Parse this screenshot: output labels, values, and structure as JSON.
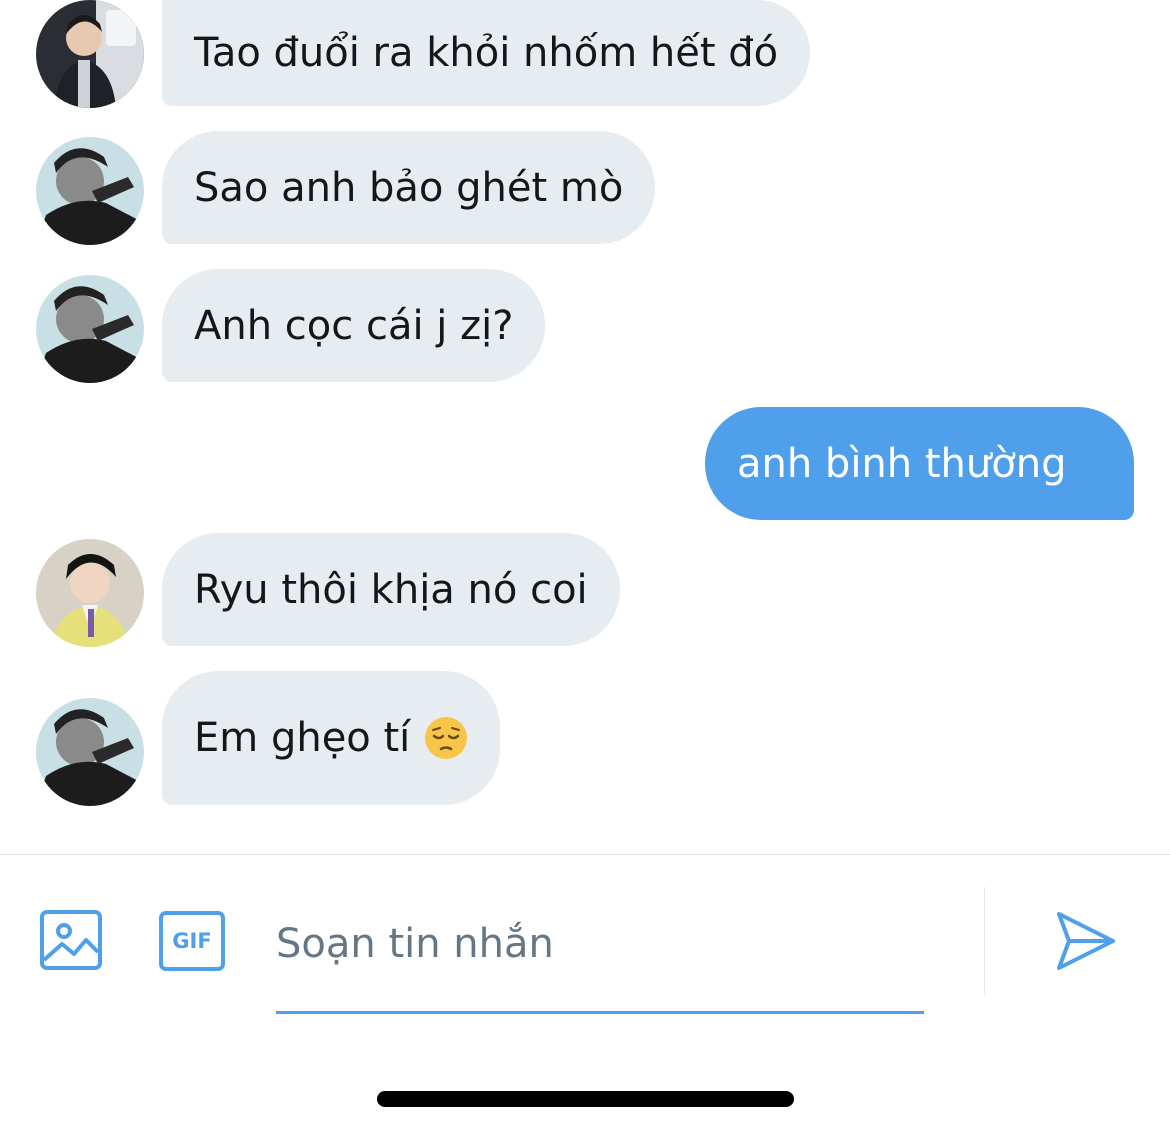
{
  "conversation": {
    "messages": [
      {
        "sender": "other",
        "avatar": "avatar-dark-jacket-mirror-selfie",
        "text": "Tao đuổi ra khỏi nhốm hết đó"
      },
      {
        "sender": "other",
        "avatar": "avatar-black-white-portrait",
        "text": "Sao anh bảo ghét mò"
      },
      {
        "sender": "other",
        "avatar": "avatar-black-white-portrait",
        "text": "Anh cọc cái j zị?"
      },
      {
        "sender": "me",
        "text": "anh bình thường"
      },
      {
        "sender": "other",
        "avatar": "avatar-yellow-cardigan",
        "text": "Ryu thôi khịa nó coi"
      },
      {
        "sender": "other",
        "avatar": "avatar-black-white-portrait",
        "text": "Em ghẹo tí",
        "emoji": "pensive-face"
      }
    ]
  },
  "composer": {
    "placeholder": "Soạn tin nhắn",
    "value": "",
    "image_button_icon": "image-icon",
    "gif_button_label": "GIF",
    "send_button_icon": "send-icon"
  },
  "colors": {
    "incoming_bubble": "#e6ecf0",
    "outgoing_bubble": "#4f9fea",
    "accent": "#4f9fea",
    "text": "#14171a",
    "placeholder": "#657786"
  }
}
